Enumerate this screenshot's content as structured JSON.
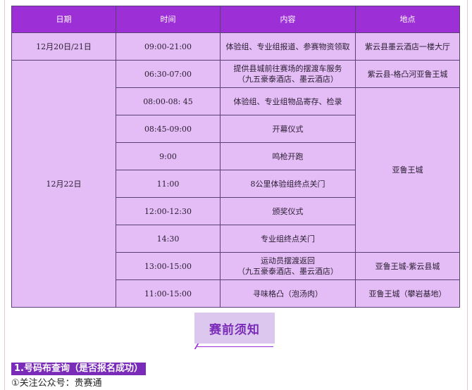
{
  "table": {
    "headers": [
      "日期",
      "时间",
      "内容",
      "地点"
    ],
    "rows": [
      {
        "date": "12月20日/21日",
        "time": "09:00-21:00",
        "content": "体验组、专业组报道、参赛物资领取",
        "location": "紫云县墨云酒店一楼大厅"
      },
      {
        "date": "12月22日",
        "time": "06:30-07:00",
        "content_l1": "提供县城前往赛场的摆渡车服务",
        "content_l2": "（九五豪泰酒店、墨云酒店）",
        "location": "紫云县-格凸河亚鲁王城"
      },
      {
        "time": "08:00-08: 45",
        "content": "体验组、专业组物品寄存、检录",
        "location": "亚鲁王城"
      },
      {
        "time": "08:45-09:00",
        "content": "开幕仪式"
      },
      {
        "time": "9:00",
        "content": "鸣枪开跑"
      },
      {
        "time": "11:00",
        "content": "8公里体验组终点关门"
      },
      {
        "time": "12:00-12:30",
        "content": "颁奖仪式"
      },
      {
        "time": "14:30",
        "content": "专业组终点关门"
      },
      {
        "time": "13:00-15:00",
        "content_l1": "运动员摆渡返回",
        "content_l2": "（九五豪泰酒店、墨云酒店）",
        "location": "亚鲁王城-紫云县城"
      },
      {
        "time": "11:00-15:00",
        "content": "寻味格凸（泡汤肉）",
        "location": "亚鲁王城（攀岩基地）"
      }
    ]
  },
  "section_title": "赛前须知",
  "subsection": "1.号码布查询（是否报名成功）",
  "step1": "①关注公众号：贵赛通",
  "colors": {
    "header_bg": "#9c2fd6",
    "cell_bg": "#e4bcf6",
    "accent": "#7a2bb8"
  }
}
